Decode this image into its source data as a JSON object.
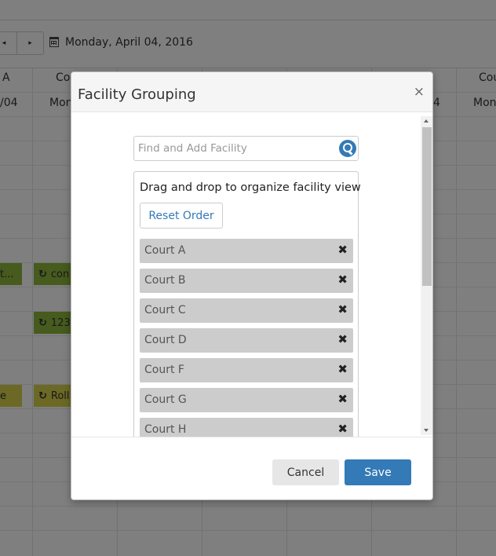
{
  "background": {
    "date": "Monday, April 04, 2016",
    "prev_label": "◂",
    "next_label": "▸",
    "col_heads_row1": [
      "A",
      "Cou",
      "Cou"
    ],
    "col_heads_row2": [
      "/04",
      "Mon",
      "4",
      "Mon"
    ],
    "events": [
      "t...",
      "con",
      "123",
      "e",
      "Roll"
    ]
  },
  "modal": {
    "title": "Facility Grouping",
    "close_label": "×",
    "search_placeholder": "Find and Add Facility",
    "heading": "Drag and drop to organize facility view",
    "reset_label": "Reset Order",
    "facilities": [
      "Court A",
      "Court B",
      "Court C",
      "Court D",
      "Court F",
      "Court G",
      "Court H"
    ],
    "remove_glyph": "✖",
    "cancel_label": "Cancel",
    "save_label": "Save"
  },
  "colors": {
    "primary": "#337ab7",
    "event_green": "#8db63a",
    "event_yellow": "#d6d24a",
    "item_bg": "#cccccc"
  }
}
